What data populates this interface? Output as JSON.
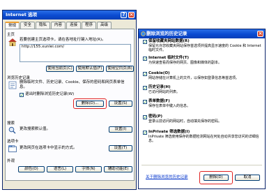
{
  "internet_options": {
    "title": "Internet 选项",
    "tabs": [
      "常规",
      "安全",
      "隐私",
      "内容",
      "连接",
      "程序",
      "高级"
    ],
    "home": {
      "group": "主页",
      "desc": "若要创建主页选项卡，请在各地址行键入地址(R)。",
      "url": "http://155.xunlei.com/",
      "buttons": [
        "使用当前页(C)",
        "使用默认值(F)",
        "使用空白页(B)"
      ]
    },
    "history": {
      "group": "浏览历史记录",
      "desc": "删除临时文件、历史记录、Cookie、保存的密码和网页表单信息。",
      "checkbox": "退出时删除浏览历史记录(W)",
      "buttons": [
        "删除(D)...",
        "设置(S)"
      ]
    },
    "search": {
      "group": "搜索",
      "desc": "更改搜索默认值。",
      "button": "设置(I)"
    },
    "tabsgroup": {
      "group": "选项卡",
      "desc": "更改网页在选项卡中显示的方式。",
      "button": "设置(T)"
    },
    "appearance": {
      "group": "外观",
      "buttons": [
        "颜色(O)",
        "语言(L)",
        "字体(N)",
        "辅助功能(E)"
      ]
    }
  },
  "delete_history": {
    "title": "删除浏览的历史记录",
    "items": [
      {
        "title": "保留收藏夹网站数据(R)",
        "desc": "保留允许您收藏夹网站保存首选项并提高显示速度的 Cookie 和 Internet 临时文件。",
        "checked": true
      },
      {
        "title": "Internet 临时文件(T)",
        "desc": "为快速查看而保存的网页、图像和媒体的副本。",
        "checked": true
      },
      {
        "title": "Cookie(O)",
        "desc": "网站存储在计算机上的文件，以保存如登录信息等首选项。",
        "checked": true
      },
      {
        "title": "历史记录(H)",
        "desc": "已访问网站的列表。",
        "checked": true
      },
      {
        "title": "表单数据(F)",
        "desc": "保存在表单中键入的信息。",
        "checked": true
      },
      {
        "title": "密码(P)",
        "desc": "登录以前访问的网站时，自动填充保存的密码。",
        "checked": true
      },
      {
        "title": "InPrivate 筛选数据(I)",
        "desc": "InPrivate 筛选使用保存的数据检测网站在何处自动共享您访问的详细信息。",
        "checked": true
      }
    ],
    "link": "关于删除浏览的历史记录",
    "buttons": [
      "删除(D)",
      "取消"
    ]
  },
  "colors": {
    "accent": "#0a4bd1",
    "highlight": "#e02020"
  }
}
